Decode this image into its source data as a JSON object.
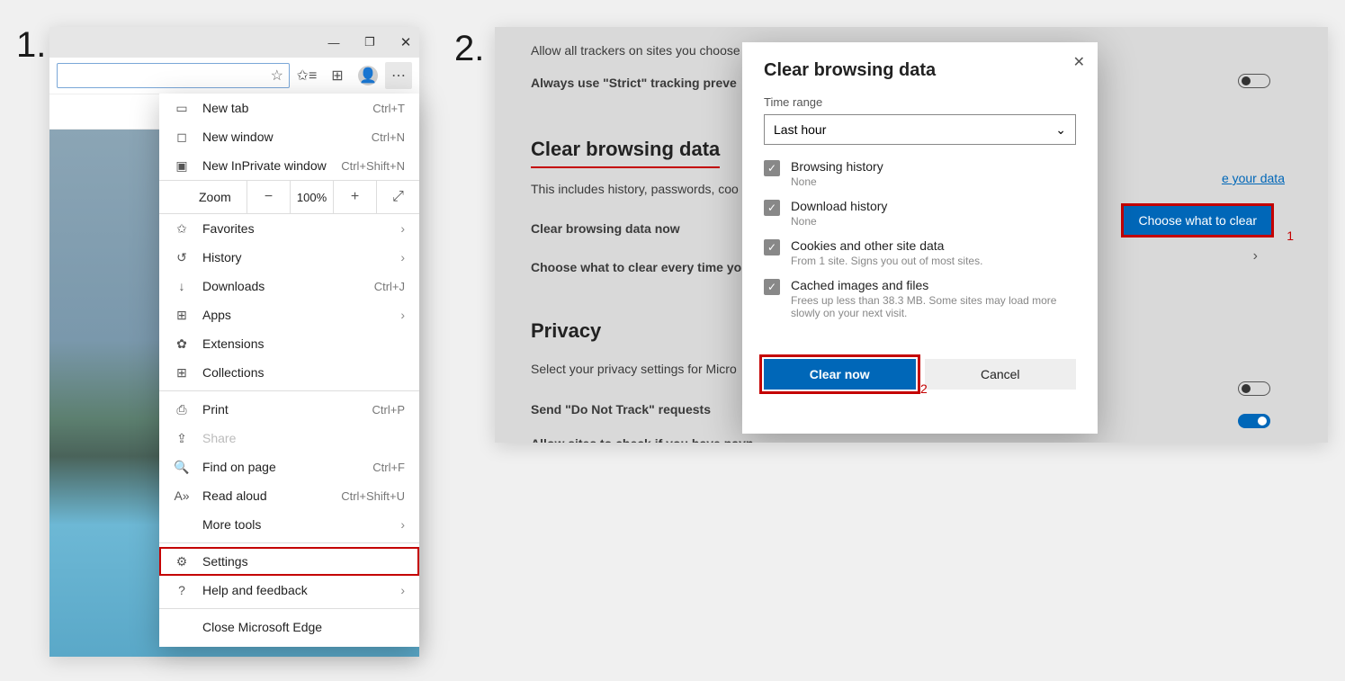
{
  "steps": {
    "s1": "1.",
    "s2": "2."
  },
  "titlebar": {
    "min": "—",
    "max": "❐",
    "close": "✕"
  },
  "toolbar": {
    "star": "☆",
    "favlist": "✩≡",
    "collections": "⊞",
    "more": "⋯"
  },
  "menu": {
    "newtab": {
      "label": "New tab",
      "sc": "Ctrl+T"
    },
    "newwin": {
      "label": "New window",
      "sc": "Ctrl+N"
    },
    "inprivate": {
      "label": "New InPrivate window",
      "sc": "Ctrl+Shift+N"
    },
    "zoom": {
      "label": "Zoom",
      "minus": "−",
      "pct": "100%",
      "plus": "+",
      "full": "⤢"
    },
    "favorites": {
      "label": "Favorites"
    },
    "history": {
      "label": "History"
    },
    "downloads": {
      "label": "Downloads",
      "sc": "Ctrl+J"
    },
    "apps": {
      "label": "Apps"
    },
    "extensions": {
      "label": "Extensions"
    },
    "collections": {
      "label": "Collections"
    },
    "print": {
      "label": "Print",
      "sc": "Ctrl+P"
    },
    "share": {
      "label": "Share"
    },
    "find": {
      "label": "Find on page",
      "sc": "Ctrl+F"
    },
    "readaloud": {
      "label": "Read aloud",
      "sc": "Ctrl+Shift+U"
    },
    "moretools": {
      "label": "More tools"
    },
    "settings": {
      "label": "Settings"
    },
    "help": {
      "label": "Help and feedback"
    },
    "close": {
      "label": "Close Microsoft Edge"
    },
    "chev": "›"
  },
  "settings": {
    "trackerLine": "Allow all trackers on sites you choose",
    "strictLine": "Always use \"Strict\" tracking preve",
    "heading1": "Clear browsing data",
    "desc1": "This includes history, passwords, coo",
    "row1": "Clear browsing data now",
    "row2": "Choose what to clear every time yo",
    "heading2": "Privacy",
    "desc2": "Select your privacy settings for Micro",
    "row3": "Send \"Do Not Track\" requests",
    "row4": "Allow sites to check if you have payn",
    "link": "e your data",
    "btn": "Choose what to clear",
    "ann1": "1",
    "chev": "›"
  },
  "dialog": {
    "title": "Clear browsing data",
    "close": "✕",
    "timelabel": "Time range",
    "timeval": "Last hour",
    "chev": "⌄",
    "items": {
      "browsing": {
        "label": "Browsing history",
        "sub": "None"
      },
      "download": {
        "label": "Download history",
        "sub": "None"
      },
      "cookies": {
        "label": "Cookies and other site data",
        "sub": "From 1 site. Signs you out of most sites."
      },
      "cached": {
        "label": "Cached images and files",
        "sub": "Frees up less than 38.3 MB. Some sites may load more slowly on your next visit."
      }
    },
    "clearBtn": "Clear now",
    "cancelBtn": "Cancel",
    "check": "✓",
    "ann2": "2"
  }
}
